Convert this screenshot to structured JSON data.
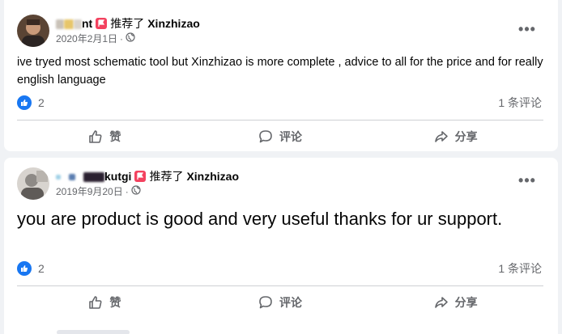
{
  "posts": [
    {
      "author_visible": "nt",
      "recommended_text": "推荐了",
      "page_name": "Xinzhizao",
      "date": "2020年2月1日",
      "separator": "·",
      "privacy_icon": "globe-icon",
      "text": "ive tryed most schematic tool but Xinzhizao is more complete , advice to all for the price and for really english language",
      "like_count": "2",
      "comment_count": "1 条评论",
      "actions": {
        "like": "赞",
        "comment": "评论",
        "share": "分享"
      }
    },
    {
      "author_visible": "kutgi",
      "recommended_text": "推荐了",
      "page_name": "Xinzhizao",
      "date": "2019年9月20日",
      "separator": "·",
      "privacy_icon": "globe-icon",
      "text": "you are product is good and very useful thanks for ur support.",
      "like_count": "2",
      "comment_count": "1 条评论",
      "actions": {
        "like": "赞",
        "comment": "评论",
        "share": "分享"
      }
    }
  ],
  "more_glyph": "•••",
  "colors": {
    "background": "#f0f2f5",
    "card": "#ffffff",
    "primary_text": "#050505",
    "secondary_text": "#65676b",
    "like_blue": "#1877f2",
    "recommend_red": "#f3425f",
    "divider": "#ced0d4"
  }
}
